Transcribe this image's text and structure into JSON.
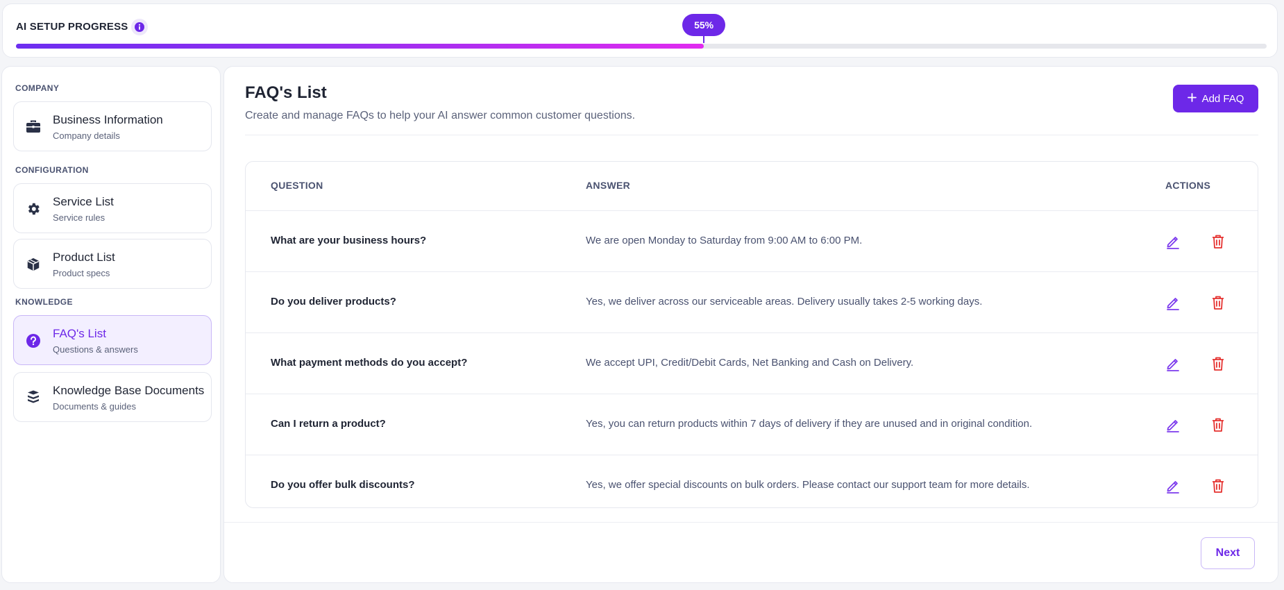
{
  "progress": {
    "title": "AI SETUP PROGRESS",
    "value": 0.55,
    "label": "55%",
    "colors": {
      "start": "#6c2ef0",
      "end": "#e12bf0",
      "bubble": "#6d28e8"
    }
  },
  "sidebar": {
    "sections": [
      {
        "label": "COMPANY"
      },
      {
        "label": "CONFIGURATION"
      },
      {
        "label": "KNOWLEDGE"
      }
    ],
    "items": [
      {
        "title": "Business Information",
        "subtitle": "Company details",
        "icon": "briefcase-icon"
      },
      {
        "title": "Service List",
        "subtitle": "Service rules",
        "icon": "gear-icon"
      },
      {
        "title": "Product List",
        "subtitle": "Product specs",
        "icon": "box-icon"
      },
      {
        "title": "FAQ's List",
        "subtitle": "Questions & answers",
        "icon": "question-circle-icon",
        "active": true
      },
      {
        "title": "Knowledge Base Documents",
        "subtitle": "Documents & guides",
        "icon": "database-icon"
      }
    ]
  },
  "main": {
    "title": "FAQ's List",
    "description": "Create and manage FAQs to help your AI answer common customer questions.",
    "add_button": "Add FAQ",
    "next_button": "Next",
    "accent": "#6d28e8",
    "danger": "#e5312f"
  },
  "table": {
    "headers": {
      "question": "QUESTION",
      "answer": "ANSWER",
      "actions": "ACTIONS"
    },
    "rows": [
      {
        "question": "What are your business hours?",
        "answer": "We are open Monday to Saturday from 9:00 AM to 6:00 PM."
      },
      {
        "question": "Do you deliver products?",
        "answer": "Yes, we deliver across our serviceable areas. Delivery usually takes 2-5 working days."
      },
      {
        "question": "What payment methods do you accept?",
        "answer": "We accept UPI, Credit/Debit Cards, Net Banking and Cash on Delivery."
      },
      {
        "question": "Can I return a product?",
        "answer": "Yes, you can return products within 7 days of delivery if they are unused and in original condition."
      },
      {
        "question": "Do you offer bulk discounts?",
        "answer": "Yes, we offer special discounts on bulk orders. Please contact our support team for more details."
      }
    ]
  }
}
